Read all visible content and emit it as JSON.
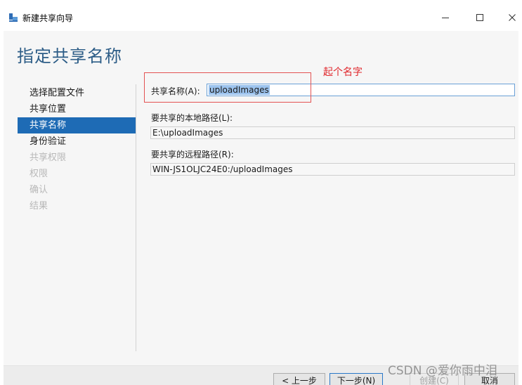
{
  "window": {
    "title": "新建共享向导",
    "icon": "share-wizard-icon",
    "controls": {
      "minimize": "minimize-icon",
      "maximize": "maximize-icon",
      "close": "close-icon"
    }
  },
  "page": {
    "heading": "指定共享名称"
  },
  "nav": {
    "items": [
      {
        "label": "选择配置文件",
        "state": "normal"
      },
      {
        "label": "共享位置",
        "state": "normal"
      },
      {
        "label": "共享名称",
        "state": "selected"
      },
      {
        "label": "身份验证",
        "state": "normal"
      },
      {
        "label": "共享权限",
        "state": "disabled"
      },
      {
        "label": "权限",
        "state": "disabled"
      },
      {
        "label": "确认",
        "state": "disabled"
      },
      {
        "label": "结果",
        "state": "disabled"
      }
    ]
  },
  "form": {
    "share_name": {
      "label": "共享名称(A):",
      "value": "uploadImages"
    },
    "local_path": {
      "label": "要共享的本地路径(L):",
      "value": "E:\\uploadImages"
    },
    "remote_path": {
      "label": "要共享的远程路径(R):",
      "value": "WIN-JS1OLJC24E0:/uploadImages"
    }
  },
  "annotation": {
    "text": "起个名字",
    "color": "#e0262b"
  },
  "buttons": {
    "prev": "< 上一步(P)",
    "next": "下一步(N) >",
    "create": "创建(C)",
    "cancel": "取消"
  },
  "watermark": "CSDN @爱你雨中泪",
  "colors": {
    "accent": "#1e6bb5",
    "heading": "#2d5d87",
    "selection": "#9cc3ee"
  }
}
